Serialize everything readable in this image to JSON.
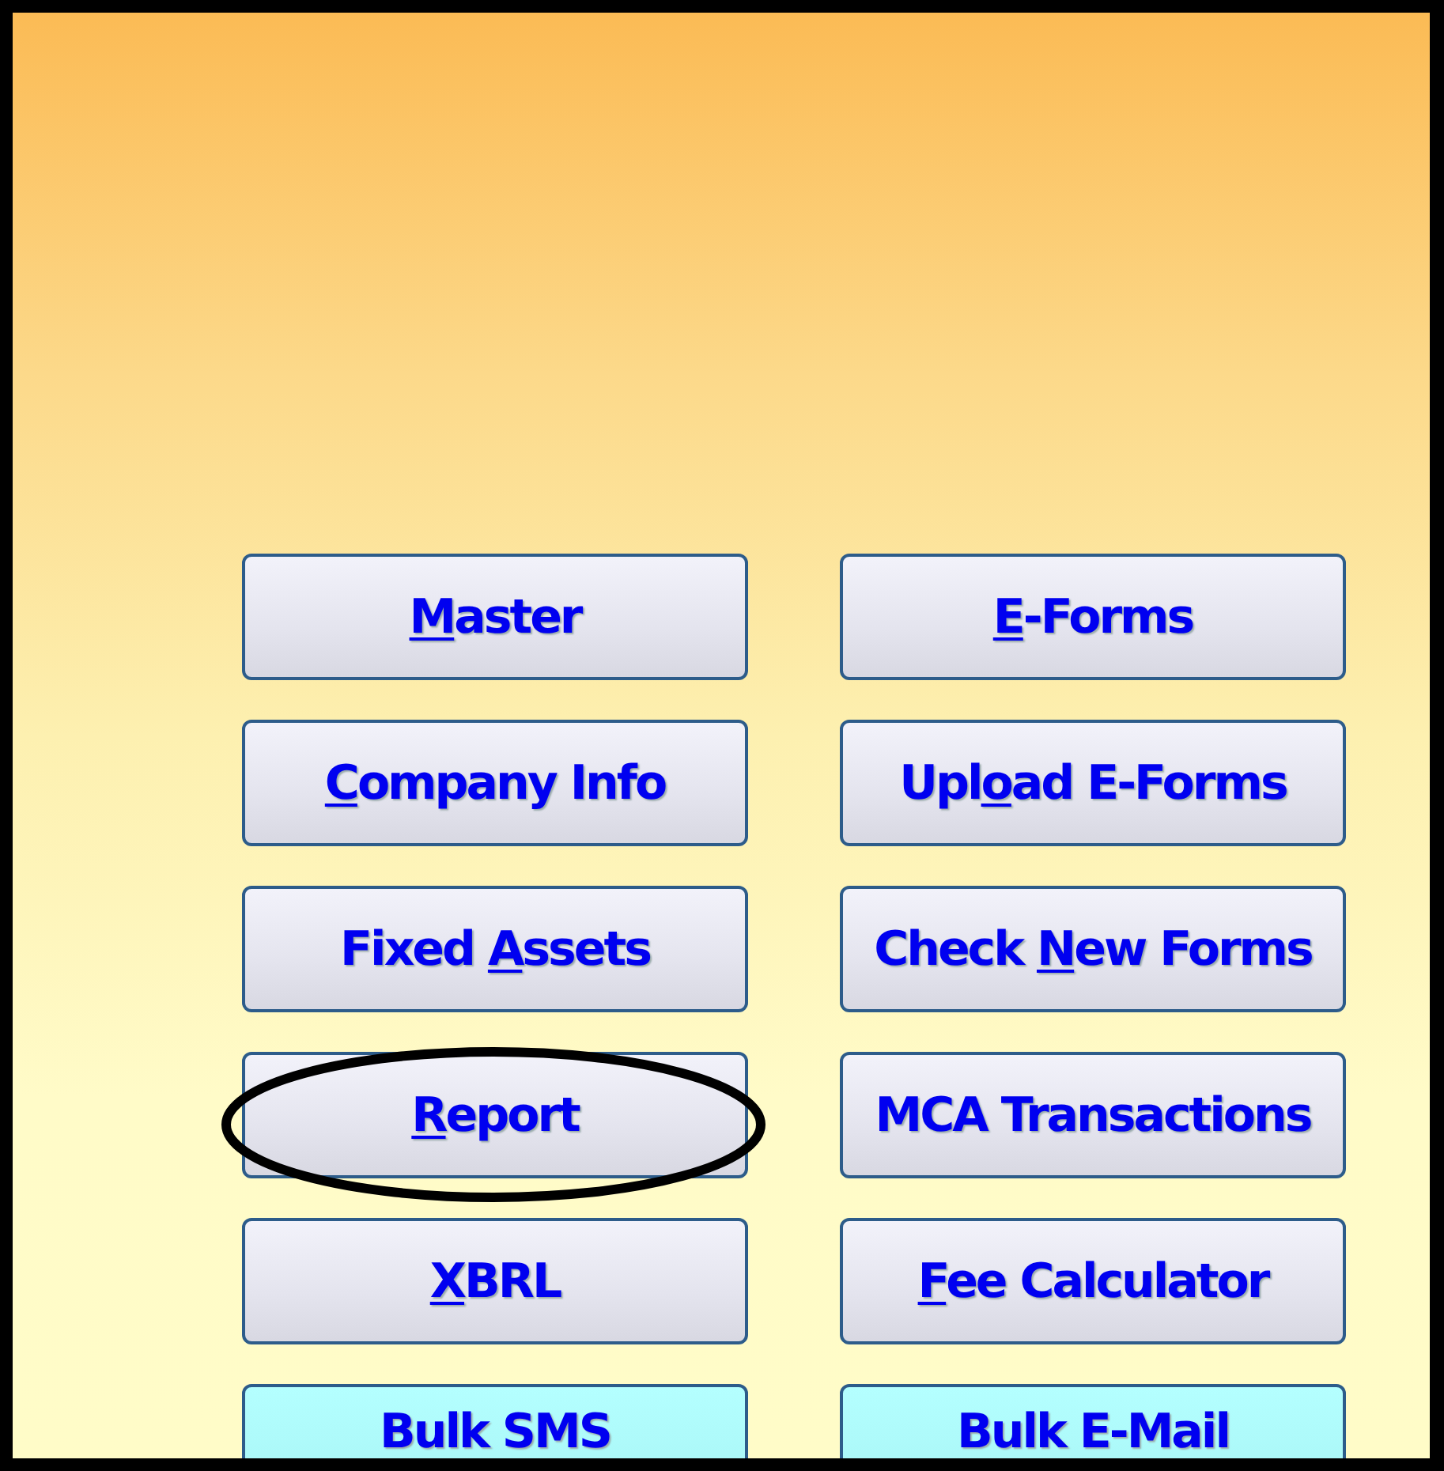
{
  "buttons": [
    {
      "kind": "standard",
      "access_key": "M",
      "label_after": "aster",
      "circled": false
    },
    {
      "kind": "standard",
      "access_key": "E",
      "label_after": "-Forms",
      "circled": false
    },
    {
      "kind": "standard",
      "access_key": "C",
      "label_after": "ompany Info",
      "circled": false
    },
    {
      "kind": "standard",
      "label_before": "Upl",
      "access_key": "o",
      "label_after": "ad E-Forms",
      "circled": false
    },
    {
      "kind": "standard",
      "label_before": "Fixed ",
      "access_key": "A",
      "label_after": "ssets",
      "circled": false
    },
    {
      "kind": "standard",
      "label_before": "Check ",
      "access_key": "N",
      "label_after": "ew Forms",
      "circled": false
    },
    {
      "kind": "standard",
      "access_key": "R",
      "label_after": "eport",
      "circled": true
    },
    {
      "kind": "standard",
      "label_after": "MCA Transactions",
      "circled": false
    },
    {
      "kind": "standard",
      "access_key": "X",
      "label_after": "BRL",
      "circled": false
    },
    {
      "kind": "standard",
      "access_key": "F",
      "label_after": "ee Calculator",
      "circled": false
    },
    {
      "kind": "bulk",
      "label_after": "Bulk SMS",
      "circled": false
    },
    {
      "kind": "bulk",
      "label_after": "Bulk E-Mail",
      "circled": false
    }
  ]
}
